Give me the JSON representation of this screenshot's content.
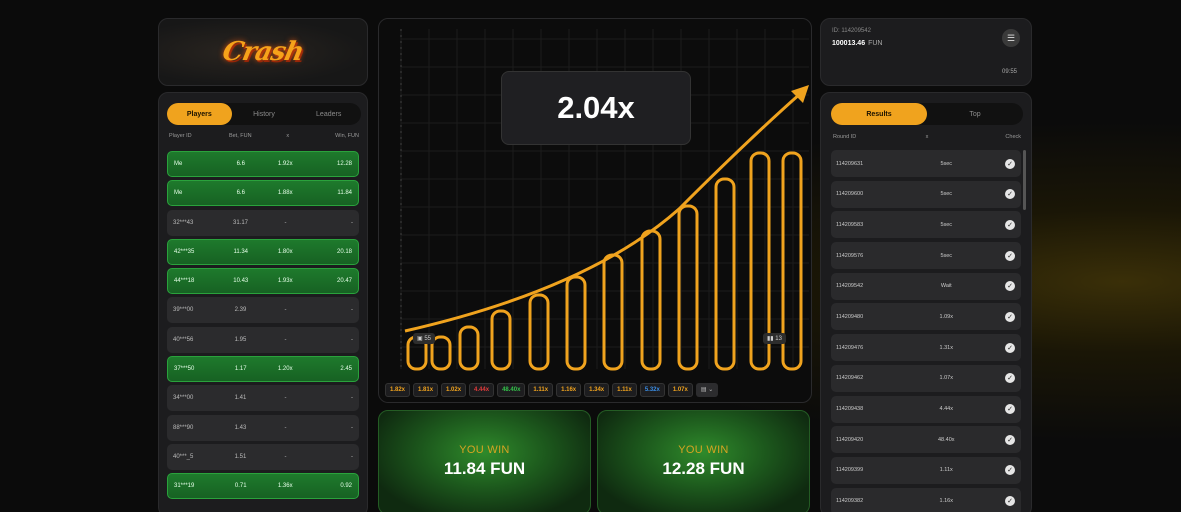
{
  "logo": {
    "text": "Crash"
  },
  "left": {
    "tabs": [
      "Players",
      "History",
      "Leaders"
    ],
    "columns": [
      "Player ID",
      "Bet, FUN",
      "x",
      "Win, FUN"
    ],
    "rows": [
      {
        "id": "Me",
        "bet": "6.6",
        "x": "1.92x",
        "win": "12.28",
        "won": true
      },
      {
        "id": "Me",
        "bet": "6.6",
        "x": "1.88x",
        "win": "11.84",
        "won": true
      },
      {
        "id": "32***43",
        "bet": "31.17",
        "x": "-",
        "win": "-",
        "won": false
      },
      {
        "id": "42***35",
        "bet": "11.34",
        "x": "1.80x",
        "win": "20.18",
        "won": true
      },
      {
        "id": "44***18",
        "bet": "10.43",
        "x": "1.93x",
        "win": "20.47",
        "won": true
      },
      {
        "id": "39***00",
        "bet": "2.39",
        "x": "-",
        "win": "-",
        "won": false
      },
      {
        "id": "40***56",
        "bet": "1.95",
        "x": "-",
        "win": "-",
        "won": false
      },
      {
        "id": "37***50",
        "bet": "1.17",
        "x": "1.20x",
        "win": "2.45",
        "won": true
      },
      {
        "id": "34***00",
        "bet": "1.41",
        "x": "-",
        "win": "-",
        "won": false
      },
      {
        "id": "88***90",
        "bet": "1.43",
        "x": "-",
        "win": "-",
        "won": false
      },
      {
        "id": "40***_5",
        "bet": "1.51",
        "x": "-",
        "win": "-",
        "won": false
      },
      {
        "id": "31***19",
        "bet": "0.71",
        "x": "1.36x",
        "win": "0.92",
        "won": true
      }
    ]
  },
  "graph": {
    "multiplier": "2.04x",
    "chip_left": "55",
    "chip_right": "13",
    "history": [
      {
        "v": "1.82x",
        "c": "#f0a31e"
      },
      {
        "v": "1.81x",
        "c": "#f0a31e"
      },
      {
        "v": "1.02x",
        "c": "#f0a31e"
      },
      {
        "v": "4.44x",
        "c": "#e23b3b"
      },
      {
        "v": "48.40x",
        "c": "#33c24a"
      },
      {
        "v": "1.11x",
        "c": "#f0a31e"
      },
      {
        "v": "1.16x",
        "c": "#f0a31e"
      },
      {
        "v": "1.34x",
        "c": "#f0a31e"
      },
      {
        "v": "1.11x",
        "c": "#f0a31e"
      },
      {
        "v": "5.32x",
        "c": "#3a8ee6"
      },
      {
        "v": "1.07x",
        "c": "#f0a31e"
      }
    ],
    "history_more": "▤ ⌄",
    "accent": "#f0a31e"
  },
  "wins": [
    {
      "label": "YOU WIN",
      "amount": "11.84 FUN"
    },
    {
      "label": "YOU WIN",
      "amount": "12.28 FUN"
    }
  ],
  "account": {
    "id": "ID: 114209542",
    "balance": "100013.46",
    "currency": "FUN",
    "time": "09:55"
  },
  "right": {
    "tabs": [
      "Results",
      "Top"
    ],
    "columns": [
      "Round ID",
      "x",
      "Check"
    ],
    "rows": [
      {
        "id": "114209631",
        "x": "5sec"
      },
      {
        "id": "114209600",
        "x": "5sec"
      },
      {
        "id": "114209583",
        "x": "5sec"
      },
      {
        "id": "114209576",
        "x": "5sec"
      },
      {
        "id": "114209542",
        "x": "Wait"
      },
      {
        "id": "114209480",
        "x": "1.09x"
      },
      {
        "id": "114209476",
        "x": "1.31x"
      },
      {
        "id": "114209462",
        "x": "1.07x"
      },
      {
        "id": "114209438",
        "x": "4.44x"
      },
      {
        "id": "114209420",
        "x": "48.40x"
      },
      {
        "id": "114209399",
        "x": "1.11x"
      },
      {
        "id": "114209382",
        "x": "1.16x"
      }
    ]
  }
}
